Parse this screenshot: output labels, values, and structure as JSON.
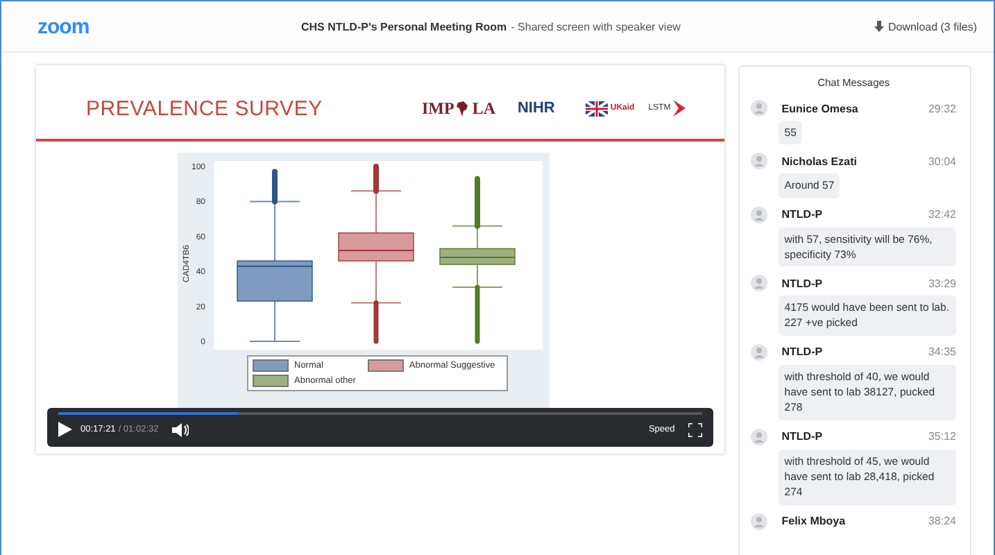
{
  "header": {
    "logo": "zoom",
    "title": "CHS NTLD-P's Personal Meeting Room",
    "subtitle": "- Shared screen with speaker view",
    "download": "Download (3 files)"
  },
  "slide": {
    "title": "PREVALENCE SURVEY",
    "logos": {
      "impala_left": "IMP",
      "impala_right": "LA",
      "nihr": "NIHR",
      "ukaid": "UKaid",
      "lstm": "LSTM"
    },
    "chart": {
      "ylabel": "CAD4TB6",
      "yticks": [
        "100",
        "80",
        "60",
        "40",
        "20",
        "0"
      ],
      "legend": [
        {
          "label": "Normal",
          "color": "#7f9bbf"
        },
        {
          "label": "Abnormal Suggestive",
          "color": "#d99a9c"
        },
        {
          "label": "Abnormal other",
          "color": "#9fb07e"
        }
      ]
    }
  },
  "player": {
    "playing": false,
    "level": 0.28,
    "current": "00:17:21",
    "total": "/ 01:02:32",
    "speed": "Speed"
  },
  "chat": {
    "title": "Chat Messages",
    "messages": [
      {
        "name": "Eunice Omesa",
        "time": "29:32",
        "text": "55"
      },
      {
        "name": "Nicholas Ezati",
        "time": "30:04",
        "text": "Around 57"
      },
      {
        "name": "NTLD-P",
        "time": "32:42",
        "text": "with 57, sensitivity will be 76%, specificity 73%"
      },
      {
        "name": "NTLD-P",
        "time": "33:29",
        "text": "4175 would have been sent to lab. 227 +ve picked"
      },
      {
        "name": "NTLD-P",
        "time": "34:35",
        "text": "with threshold of 40, we would have sent to lab 38127, pucked 278"
      },
      {
        "name": "NTLD-P",
        "time": "35:12",
        "text": "with threshold of 45, we would have sent to lab 28,418, picked 274"
      },
      {
        "name": "Felix Mboya",
        "time": "38:24"
      }
    ]
  }
}
